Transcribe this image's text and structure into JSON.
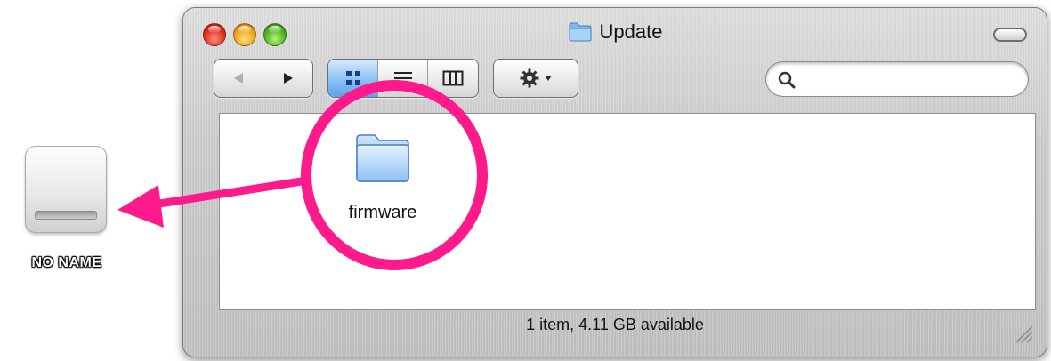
{
  "window": {
    "title": "Update",
    "status_text": "1 item, 4.11 GB available"
  },
  "toolbar": {
    "back_icon": "back-arrow-icon",
    "forward_icon": "forward-arrow-icon",
    "view_modes": [
      "icon-view",
      "list-view",
      "column-view"
    ],
    "selected_view": "icon-view",
    "action_icon": "gear-icon",
    "search": {
      "value": "",
      "placeholder": ""
    }
  },
  "content": {
    "items": [
      {
        "label": "firmware",
        "icon": "folder-icon"
      }
    ]
  },
  "desktop": {
    "drive_label": "NO NAME",
    "drive_icon": "external-drive-icon"
  },
  "annotation": {
    "color": "#ff1a8c"
  },
  "colors": {
    "close": "#e0301e",
    "minimize": "#f0a21a",
    "zoom": "#4fb51f",
    "selected_view": "#5ea4e8"
  }
}
